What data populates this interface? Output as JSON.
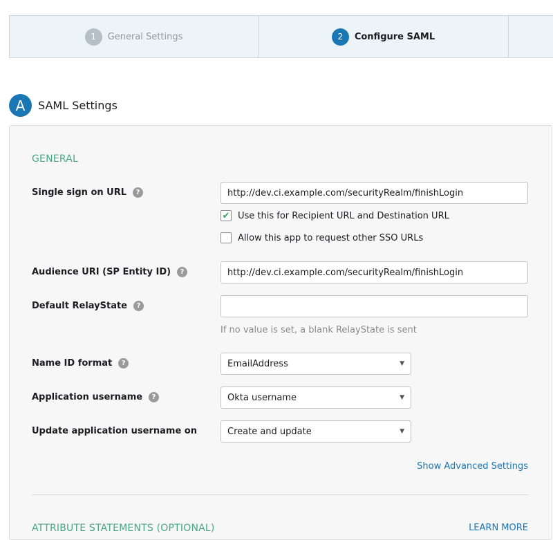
{
  "stepper": {
    "steps": [
      {
        "number": "1",
        "label": "General Settings"
      },
      {
        "number": "2",
        "label": "Configure SAML"
      }
    ]
  },
  "section": {
    "badge": "A",
    "title": "SAML Settings"
  },
  "general": {
    "title": "GENERAL",
    "sso_url": {
      "label": "Single sign on URL",
      "value": "http://dev.ci.example.com/securityRealm/finishLogin",
      "use_for_recipient_label": "Use this for Recipient URL and Destination URL",
      "use_for_recipient_checked": true,
      "allow_other_sso_label": "Allow this app to request other SSO URLs",
      "allow_other_sso_checked": false
    },
    "audience_uri": {
      "label": "Audience URI (SP Entity ID)",
      "value": "http://dev.ci.example.com/securityRealm/finishLogin"
    },
    "relay_state": {
      "label": "Default RelayState",
      "value": "",
      "hint": "If no value is set, a blank RelayState is sent"
    },
    "name_id_format": {
      "label": "Name ID format",
      "value": "EmailAddress"
    },
    "app_username": {
      "label": "Application username",
      "value": "Okta username"
    },
    "update_username_on": {
      "label": "Update application username on",
      "value": "Create and update"
    },
    "advanced_link": "Show Advanced Settings",
    "help_glyph": "?"
  },
  "attributes": {
    "title": "ATTRIBUTE STATEMENTS (OPTIONAL)",
    "learn_more": "LEARN MORE"
  },
  "colors": {
    "accent": "#1b76b4",
    "group_title": "#48a782",
    "check": "#3a9e5b"
  }
}
